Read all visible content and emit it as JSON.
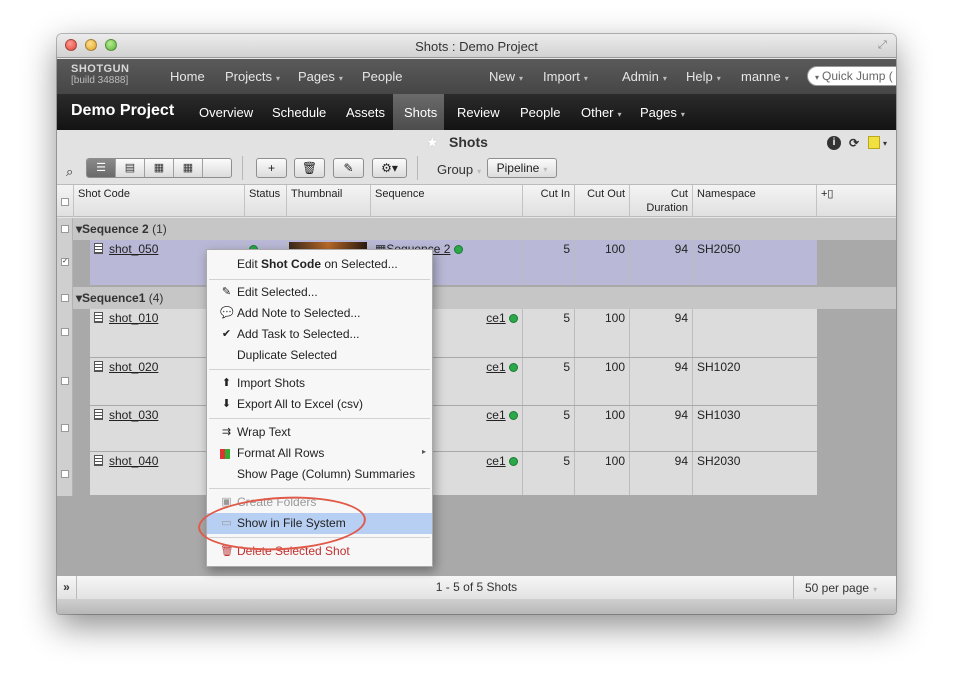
{
  "window": {
    "title": "Shots : Demo Project"
  },
  "global_nav": {
    "brand": "SHOTGUN",
    "build": "[build 34888]",
    "items": [
      {
        "label": "Home",
        "caret": false
      },
      {
        "label": "Projects",
        "caret": true
      },
      {
        "label": "Pages",
        "caret": true
      },
      {
        "label": "People",
        "caret": false
      },
      {
        "label": "New",
        "caret": true
      },
      {
        "label": "Import",
        "caret": true
      },
      {
        "label": "Admin",
        "caret": true
      },
      {
        "label": "Help",
        "caret": true
      },
      {
        "label": "manne",
        "caret": true
      }
    ],
    "quick_jump": "Quick Jump ("
  },
  "project_nav": {
    "project_title": "Demo Project",
    "tabs": [
      {
        "label": "Overview",
        "caret": false,
        "active": false
      },
      {
        "label": "Schedule",
        "caret": false,
        "active": false
      },
      {
        "label": "Assets",
        "caret": false,
        "active": false
      },
      {
        "label": "Shots",
        "caret": false,
        "active": true
      },
      {
        "label": "Review",
        "caret": false,
        "active": false
      },
      {
        "label": "People",
        "caret": false,
        "active": false
      },
      {
        "label": "Other",
        "caret": true,
        "active": false
      },
      {
        "label": "Pages",
        "caret": true,
        "active": false
      }
    ]
  },
  "page": {
    "title": "Shots",
    "toolbar": {
      "group_label": "Group",
      "pipeline_label": "Pipeline",
      "add_label": "+"
    }
  },
  "grid": {
    "columns": {
      "shot_code": "Shot Code",
      "status": "Status",
      "thumbnail": "Thumbnail",
      "sequence": "Sequence",
      "cut_in": "Cut In",
      "cut_out": "Cut Out",
      "cut_duration_1": "Cut",
      "cut_duration_2": "Duration",
      "namespace": "Namespace"
    },
    "groups": [
      {
        "name": "Sequence 2",
        "count": "(1)"
      },
      {
        "name": "Sequence1",
        "count": "(4)"
      }
    ],
    "rows": [
      {
        "shot": "shot_050",
        "sequence": "Sequence 2",
        "cut_in": "5",
        "cut_out": "100",
        "duration": "94",
        "namespace": "SH2050"
      },
      {
        "shot": "shot_010",
        "sequence": "ce1",
        "cut_in": "5",
        "cut_out": "100",
        "duration": "94",
        "namespace": ""
      },
      {
        "shot": "shot_020",
        "sequence": "ce1",
        "cut_in": "5",
        "cut_out": "100",
        "duration": "94",
        "namespace": "SH1020"
      },
      {
        "shot": "shot_030",
        "sequence": "ce1",
        "cut_in": "5",
        "cut_out": "100",
        "duration": "94",
        "namespace": "SH1030"
      },
      {
        "shot": "shot_040",
        "sequence": "ce1",
        "cut_in": "5",
        "cut_out": "100",
        "duration": "94",
        "namespace": "SH2030"
      }
    ],
    "footer": {
      "count": "1 - 5 of 5 Shots",
      "per_page": "50 per page"
    }
  },
  "context_menu": {
    "edit_field_prefix": "Edit ",
    "edit_field_bold": "Shot Code",
    "edit_field_suffix": " on Selected...",
    "edit_selected": "Edit Selected...",
    "add_note": "Add Note to Selected...",
    "add_task": "Add Task to Selected...",
    "duplicate": "Duplicate Selected",
    "import_shots": "Import Shots",
    "export_excel": "Export All to Excel (csv)",
    "wrap_text": "Wrap Text",
    "format_rows": "Format All Rows",
    "show_summaries": "Show Page (Column) Summaries",
    "create_folders": "Create Folders",
    "show_in_fs": "Show in File System",
    "delete_shot": "Delete Selected Shot"
  },
  "colors": {
    "selected_row": "#b9b9d7",
    "menu_highlight": "#b7cff2",
    "status_green": "#2aa84a",
    "annotation_circle": "#e05a4a"
  }
}
